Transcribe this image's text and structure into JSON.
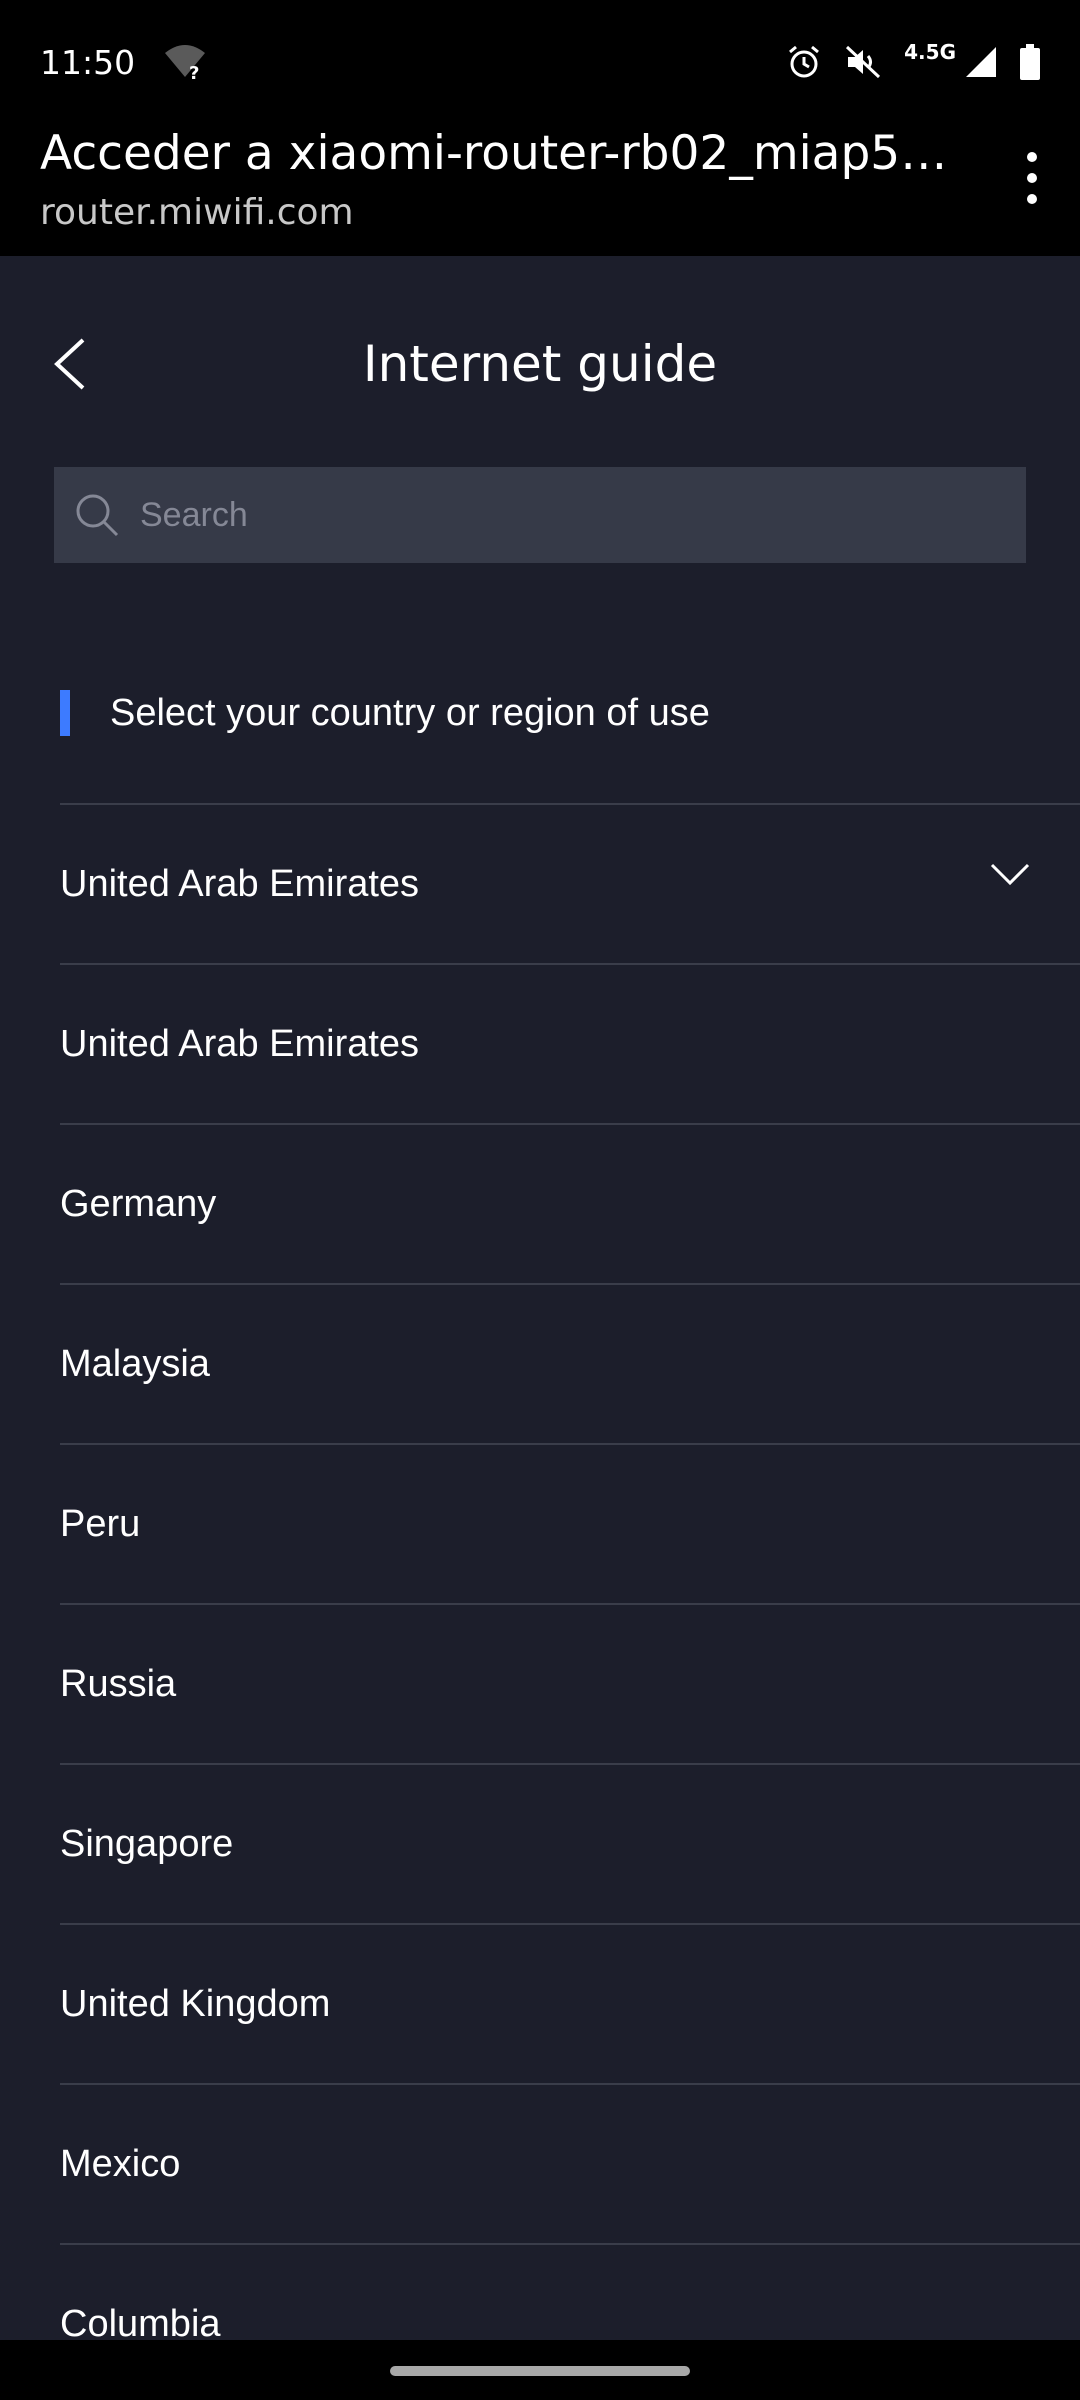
{
  "status_bar": {
    "time": "11:50",
    "network_label": "4.5G",
    "icons": [
      "wifi-unknown-icon",
      "alarm-icon",
      "vibrate-off-icon",
      "cell-signal-icon",
      "battery-icon"
    ]
  },
  "browser": {
    "title": "Acceder a xiaomi-router-rb02_miap53...",
    "url": "router.miwifi.com",
    "menu_icon": "more-vert-icon"
  },
  "header": {
    "title": "Internet guide",
    "back_icon": "chevron-left-icon"
  },
  "search": {
    "placeholder": "Search",
    "value": ""
  },
  "section": {
    "heading": "Select your country or region of use",
    "accent_color": "#3d7bff"
  },
  "countries": {
    "selected": "United Arab Emirates",
    "items": [
      "United Arab Emirates",
      "Germany",
      "Malaysia",
      "Peru",
      "Russia",
      "Singapore",
      "United Kingdom",
      "Mexico",
      "Columbia"
    ]
  },
  "colors": {
    "background": "#1c1e2b",
    "search_bg": "#363a48",
    "divider": "#3a3d4a"
  }
}
